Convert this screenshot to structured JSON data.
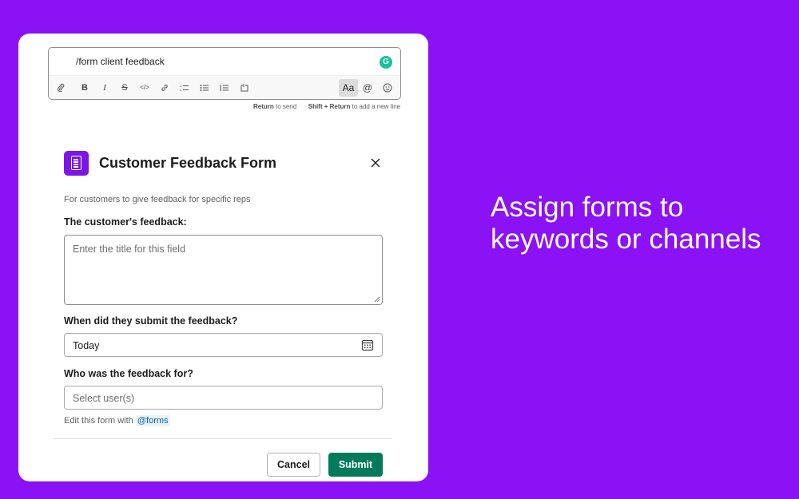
{
  "composer": {
    "text": "/form client feedback",
    "grammarly_badge": "G",
    "toolbar": {
      "items": [
        {
          "name": "attach-icon"
        },
        {
          "name": "bold-icon",
          "glyph": "B"
        },
        {
          "name": "italic-icon",
          "glyph": "I"
        },
        {
          "name": "strikethrough-icon",
          "glyph": "S"
        },
        {
          "name": "code-icon",
          "glyph": "</>"
        },
        {
          "name": "link-icon"
        },
        {
          "name": "ordered-list-icon"
        },
        {
          "name": "bulleted-list-icon"
        },
        {
          "name": "indent-icon"
        },
        {
          "name": "code-block-icon"
        }
      ],
      "format_toggle": "Aa",
      "mention_glyph": "@",
      "emoji_icon": "smile-icon"
    },
    "hint": {
      "return_key": "Return",
      "return_text": "to send",
      "shift_key": "Shift + Return",
      "shift_text": "to add a new line"
    }
  },
  "modal": {
    "title": "Customer Feedback Form",
    "icon": "form-document-icon",
    "description": "For customers to give feedback for specific reps",
    "fields": [
      {
        "label": "The customer's feedback:",
        "placeholder": "Enter the title for this field"
      },
      {
        "label": "When did they submit the feedback?",
        "value": "Today",
        "icon": "calendar-icon"
      },
      {
        "label": "Who was the feedback for?",
        "placeholder": "Select user(s)"
      }
    ],
    "edit_note": "Edit this form with",
    "edit_mention": "@forms",
    "cancel_label": "Cancel",
    "submit_label": "Submit"
  },
  "tagline": "Assign forms to keywords or channels",
  "colors": {
    "background": "#8a12f5",
    "submit": "#007a5a",
    "form_icon": "#7b16e6",
    "grammarly": "#15c39a"
  }
}
